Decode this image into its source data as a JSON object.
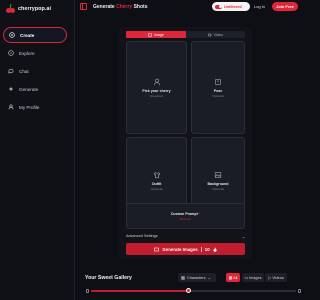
{
  "brand": {
    "name": "cherrypop.ai",
    "accent": "#e0263a"
  },
  "sidebar": {
    "items": [
      {
        "label": "Create",
        "icon": "plus-circle-icon",
        "active": true
      },
      {
        "label": "Explore",
        "icon": "compass-icon",
        "active": false
      },
      {
        "label": "Chat",
        "icon": "chat-bubble-icon",
        "active": false
      },
      {
        "label": "Generate",
        "icon": "sparkle-icon",
        "active": false
      },
      {
        "label": "My Profile",
        "icon": "user-icon",
        "active": false
      }
    ]
  },
  "header": {
    "title_prefix": "Generate",
    "title_accent": "Cherry",
    "title_suffix": "Shots",
    "unfiltered_label": "Unfiltered",
    "login_label": "Log in",
    "join_label": "Join Free"
  },
  "generator": {
    "tabs": [
      {
        "label": "Image",
        "icon": "image-icon",
        "active": true
      },
      {
        "label": "Video",
        "icon": "video-icon",
        "active": false
      }
    ],
    "tiles": {
      "cherry": {
        "label": "Pick your cherry",
        "sub": "Required"
      },
      "pose": {
        "label": "Pose",
        "sub": "Optional"
      },
      "outfit": {
        "label": "Outfit",
        "sub": "Optional"
      },
      "background": {
        "label": "Background",
        "sub": "Optional"
      },
      "prompt": {
        "label": "Custom Prompt",
        "sub": "Remove"
      }
    },
    "advanced_label": "Advanced Settings",
    "generate_label": "Generate Images",
    "generate_count": "10"
  },
  "gallery": {
    "title": "Your Sweet Gallery",
    "filter_dropdown": "Characters",
    "filters": [
      {
        "label": "All",
        "active": true
      },
      {
        "label": "Images",
        "active": false
      },
      {
        "label": "Videos",
        "active": false
      }
    ],
    "slider_position": 0.48
  }
}
